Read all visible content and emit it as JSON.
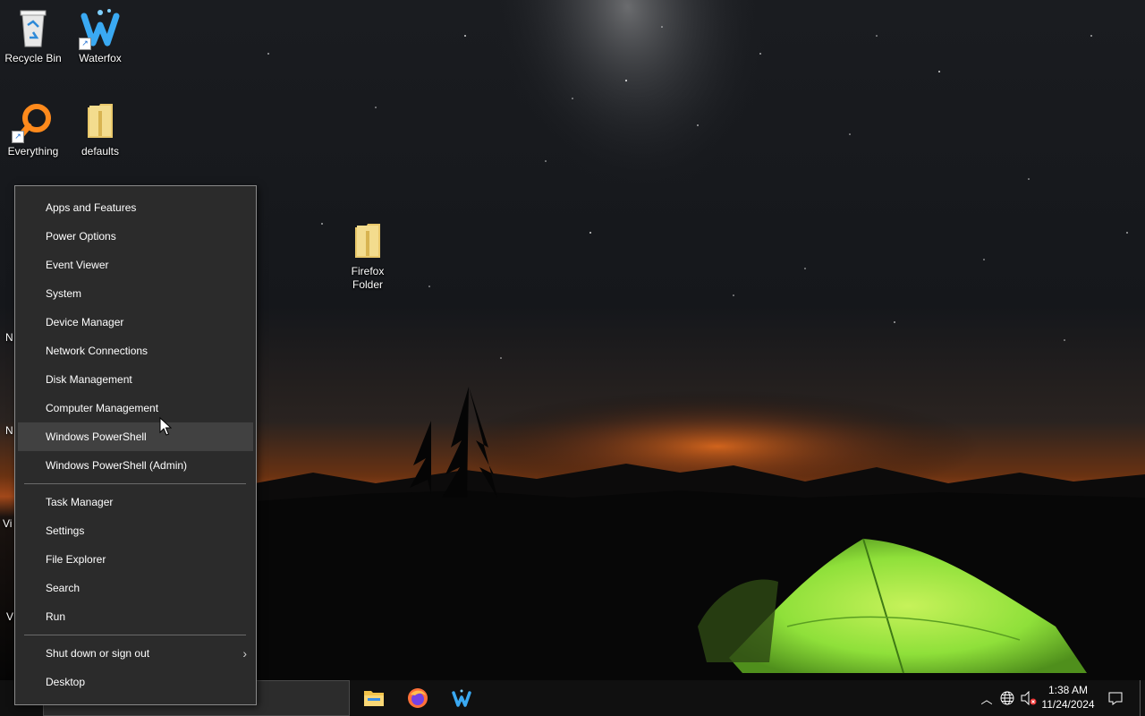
{
  "desktop": {
    "icons": [
      {
        "label": "Recycle Bin",
        "icon": "recycle-bin-icon"
      },
      {
        "label": "Waterfox",
        "icon": "waterfox-icon"
      },
      {
        "label": "Everything",
        "icon": "everything-search-icon"
      },
      {
        "label": "defaults",
        "icon": "folder-icon"
      },
      {
        "label": "Firefox\nFolder",
        "icon": "folder-icon"
      }
    ],
    "partial_labels": [
      "N",
      "N",
      "Vi",
      "V"
    ]
  },
  "context_menu": {
    "items_group1": [
      "Apps and Features",
      "Power Options",
      "Event Viewer",
      "System",
      "Device Manager",
      "Network Connections",
      "Disk Management",
      "Computer Management",
      "Windows PowerShell",
      "Windows PowerShell (Admin)"
    ],
    "items_group2": [
      "Task Manager",
      "Settings",
      "File Explorer",
      "Search",
      "Run"
    ],
    "items_group3": [
      "Shut down or sign out",
      "Desktop"
    ],
    "hovered_item": "Windows PowerShell",
    "submenu_chevron": "chevron-right-icon"
  },
  "taskbar": {
    "pinned": [
      "file-explorer-icon",
      "firefox-icon",
      "waterfox-icon"
    ],
    "tray": {
      "overflow_icon": "chevron-up-icon",
      "network_icon": "globe-icon",
      "volume_icon": "speaker-muted-icon",
      "notification_icon": "action-center-icon"
    },
    "clock": {
      "time": "1:38 AM",
      "date": "11/24/2024"
    }
  },
  "colors": {
    "menu_bg": "#2b2b2b",
    "menu_hover": "#414141",
    "taskbar_bg": "#101010",
    "tent_green": "#8fe03a",
    "horizon_orange": "#d8641a"
  }
}
